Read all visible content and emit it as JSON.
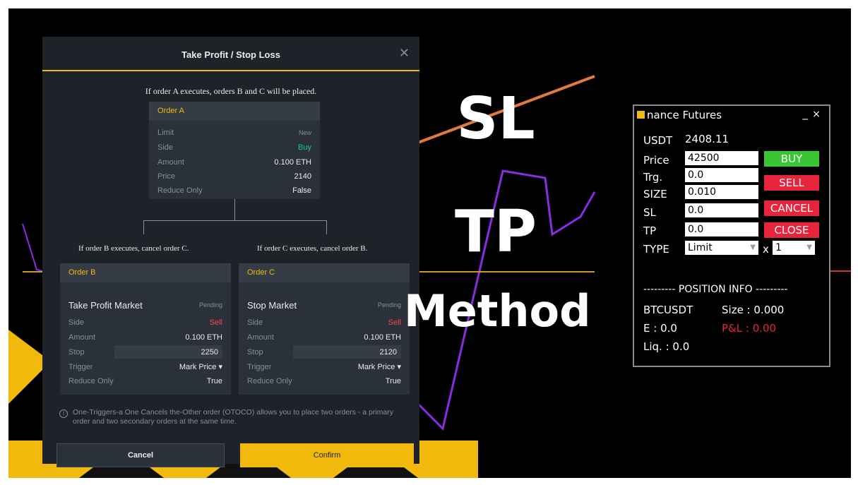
{
  "modal": {
    "title": "Take Profit / Stop Loss",
    "close_icon": "close-icon",
    "intro": "If order A executes, orders B and C will be placed.",
    "order_a": {
      "header": "Order A",
      "rows": [
        {
          "key": "Limit",
          "value": "New"
        },
        {
          "key": "Side",
          "value": "Buy"
        },
        {
          "key": "Amount",
          "value": "0.100 ETH"
        },
        {
          "key": "Price",
          "value": "2140"
        },
        {
          "key": "Reduce Only",
          "value": "False"
        }
      ]
    },
    "branch_b_label": "If order B executes, cancel order C.",
    "branch_c_label": "If order C executes, cancel order B.",
    "order_b": {
      "header": "Order B",
      "subtitle": "Take Profit Market",
      "status": "Pending",
      "side_key": "Side",
      "side_value": "Sell",
      "amount_key": "Amount",
      "amount_value": "0.100 ETH",
      "stop_key": "Stop",
      "stop_value": "2250",
      "trigger_key": "Trigger",
      "trigger_value": "Mark Price",
      "reduce_key": "Reduce Only",
      "reduce_value": "True"
    },
    "order_c": {
      "header": "Order C",
      "subtitle": "Stop Market",
      "status": "Pending",
      "side_key": "Side",
      "side_value": "Sell",
      "amount_key": "Amount",
      "amount_value": "0.100 ETH",
      "stop_key": "Stop",
      "stop_value": "2120",
      "trigger_key": "Trigger",
      "trigger_value": "Mark Price",
      "reduce_key": "Reduce Only",
      "reduce_value": "True"
    },
    "info_text": "One-Triggers-a One Cancels the-Other order (OTOCO) allows you to place two orders - a primary order and two secondary orders at the same time.",
    "cancel_label": "Cancel",
    "confirm_label": "Confirm"
  },
  "overlay_text": {
    "line1": "SL",
    "line2": "TP",
    "line3": "Method"
  },
  "widget": {
    "title": "nance Futures",
    "minimize": "_",
    "close": "×",
    "usdt_label": "USDT",
    "usdt_value": "2408.11",
    "price_label": "Price",
    "price_value": "42500",
    "trg_label": "Trg.",
    "trg_value": "0.0",
    "size_label": "SIZE",
    "size_value": "0.010",
    "sl_label": "SL",
    "sl_value": "0.0",
    "tp_label": "TP",
    "tp_value": "0.0",
    "type_label": "TYPE",
    "type_value": "Limit",
    "multiplier_x": "x",
    "multiplier_value": "1",
    "buy_label": "BUY",
    "sell_label": "SELL",
    "cancel_label": "CANCEL",
    "close_label": "CLOSE",
    "position_header": "--------- POSITION INFO ---------",
    "symbol": "BTCUSDT",
    "size_text": "Size  : 0.000",
    "entry_text": "E : 0.0",
    "pnl_text": "P&L  : 0.00",
    "liq_text": "Liq.  : 0.0"
  },
  "colors": {
    "accent": "#f0b90b",
    "buy_green": "#0ecb81",
    "sell_red": "#f6465d",
    "widget_green": "#39c534",
    "widget_red": "#e8233c",
    "chart_line": "#8b2be2"
  }
}
